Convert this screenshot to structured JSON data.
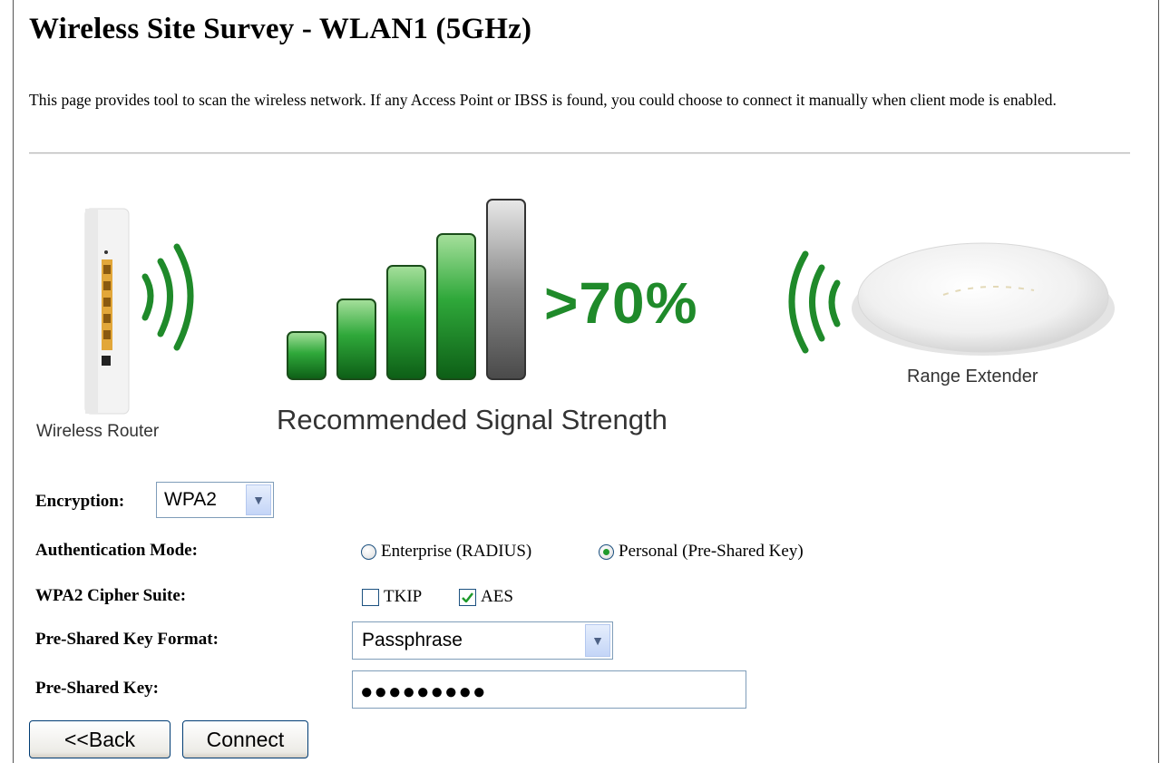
{
  "page": {
    "title": "Wireless Site Survey - WLAN1 (5GHz)",
    "description": "This page provides tool to scan the wireless network. If any Access Point or IBSS is found, you could choose to connect it manually when client mode is enabled."
  },
  "graphic": {
    "router_caption": "Wireless Router",
    "signal_caption": "Recommended Signal Strength",
    "signal_percent": ">70%",
    "extender_caption": "Range Extender",
    "signal_bars_filled": 5,
    "signal_bars_total": 6,
    "accent_color": "#1f8a2a"
  },
  "form": {
    "encryption_label": "Encryption:",
    "encryption_value": "WPA2",
    "auth_label": "Authentication Mode:",
    "auth_options": [
      {
        "label": "Enterprise (RADIUS)",
        "selected": false
      },
      {
        "label": "Personal (Pre-Shared Key)",
        "selected": true
      }
    ],
    "cipher_label": "WPA2 Cipher Suite:",
    "cipher_options": [
      {
        "label": "TKIP",
        "checked": false
      },
      {
        "label": "AES",
        "checked": true
      }
    ],
    "psk_format_label": "Pre-Shared Key Format:",
    "psk_format_value": "Passphrase",
    "psk_label": "Pre-Shared Key:",
    "psk_value": "●●●●●●●●●"
  },
  "buttons": {
    "back": "<<Back",
    "connect": "Connect"
  }
}
